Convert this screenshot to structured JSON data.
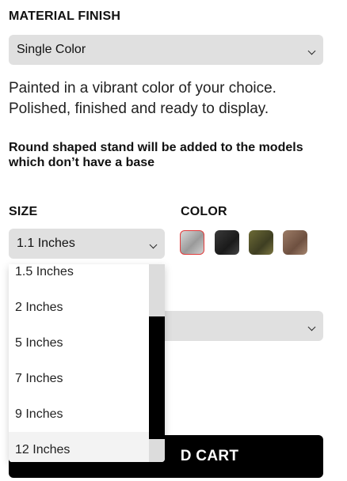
{
  "material_finish": {
    "title": "MATERIAL FINISH",
    "selected": "Single Color"
  },
  "description": {
    "line1": "Painted in a vibrant color of your choice.",
    "line2": "Polished, finished and ready to display."
  },
  "note": {
    "line1": "Round shaped stand will be added to the models",
    "line2": "which don’t have a base"
  },
  "size": {
    "title": "SIZE",
    "selected": "1.1 Inches",
    "options": [
      "1.5 Inches",
      "2 Inches",
      "5 Inches",
      "7 Inches",
      "9 Inches",
      "12 Inches"
    ],
    "hovered_option": "12 Inches"
  },
  "color": {
    "title": "COLOR",
    "swatches": [
      {
        "name": "silver",
        "color": "#b9b9b9",
        "selected": true
      },
      {
        "name": "black",
        "color": "#2a2a2a",
        "selected": false
      },
      {
        "name": "olive-gold",
        "color": "#5a5a2c",
        "selected": false
      },
      {
        "name": "bronze",
        "color": "#8a6a55",
        "selected": false
      }
    ]
  },
  "add_to_cart": {
    "visible_label": "D CART"
  }
}
